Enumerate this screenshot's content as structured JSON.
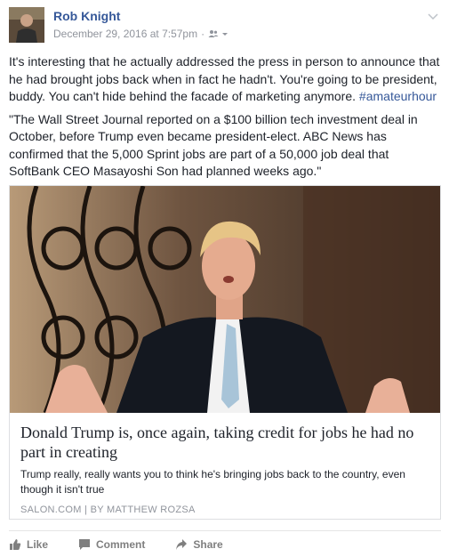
{
  "post": {
    "author": "Rob Knight",
    "timestamp": "December 29, 2016 at 7:57pm",
    "separator": "·",
    "audience_icon": "friends-icon",
    "options_icon": "chevron-down-icon",
    "paragraphs": [
      "It's interesting that he actually addressed the press in person to announce that he had brought jobs back when in fact he hadn't. You're going to be president, buddy. You can't hide behind the facade of marketing anymore.",
      "\"The Wall Street Journal reported on a $100 billion tech investment deal in October, before Trump even became president-elect. ABC News has confirmed that the 5,000 Sprint jobs are part of a 50,000 job deal that SoftBank CEO Masayoshi Son had planned weeks ago.\""
    ],
    "hashtag": "#amateurhour"
  },
  "link_card": {
    "title": "Donald Trump is, once again, taking credit for jobs he had no part in creating",
    "description": "Trump really, really wants you to think he's bringing jobs back to the country, even though it isn't true",
    "source": "SALON.COM | BY MATTHEW ROZSA"
  },
  "actions": {
    "like": "Like",
    "comment": "Comment",
    "share": "Share"
  },
  "colors": {
    "link": "#365899",
    "meta": "#90949c",
    "text": "#1d2129",
    "border": "#dddfe2"
  }
}
